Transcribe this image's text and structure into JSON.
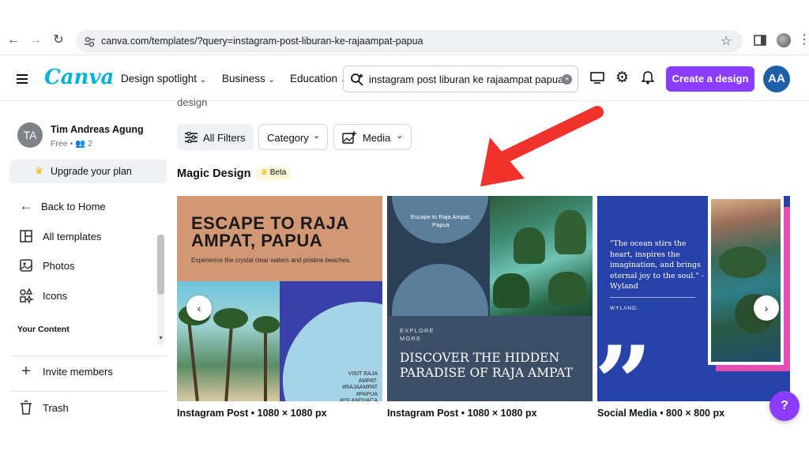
{
  "browser": {
    "url": "canva.com/templates/?query=instagram-post-liburan-ke-rajaampat-papua"
  },
  "header": {
    "logo": "Canva",
    "menu": [
      "Design spotlight",
      "Business",
      "Education"
    ],
    "search_value": "instagram post liburan ke rajaampat papua",
    "create_button": "Create a design",
    "avatar_initials": "AA"
  },
  "sidebar": {
    "user_initials": "TA",
    "user_name": "Tim Andreas Agung",
    "plan": "Free",
    "members": "2",
    "upgrade": "Upgrade your plan",
    "items": [
      "Back to Home",
      "All templates",
      "Photos",
      "Icons"
    ],
    "section_label": "Your Content",
    "invite": "Invite members",
    "trash": "Trash"
  },
  "main": {
    "partial_heading": "design",
    "filters": {
      "all": "All Filters",
      "category": "Category",
      "media": "Media"
    },
    "section_title": "Magic Design",
    "beta": "Beta",
    "cards": [
      {
        "title": "ESCAPE TO RAJA AMPAT, PAPUA",
        "subtitle": "Experience the crystal clear waters and pristine beaches.",
        "tag": "VISIT RAJA AMPAT. #RAJAAMPAT #PAPUA #ISLANDVACA",
        "caption": "Instagram Post • 1080 × 1080 px"
      },
      {
        "top_text": "Escape to Raja Ampat, Papua",
        "explore": "EXPLORE MORE",
        "headline": "DISCOVER THE HIDDEN PARADISE OF RAJA AMPAT",
        "caption": "Instagram Post • 1080 × 1080 px"
      },
      {
        "quote": "\"The ocean stirs the heart, inspires the imagination, and brings eternal joy to the soul.\" - Wyland",
        "author": "WYLAND.",
        "caption": "Social Media • 800 × 800 px"
      }
    ],
    "help": "?"
  },
  "colors": {
    "brand": "#8b3dff",
    "logo": "#00b2d6",
    "arrow": "#f0322d"
  }
}
